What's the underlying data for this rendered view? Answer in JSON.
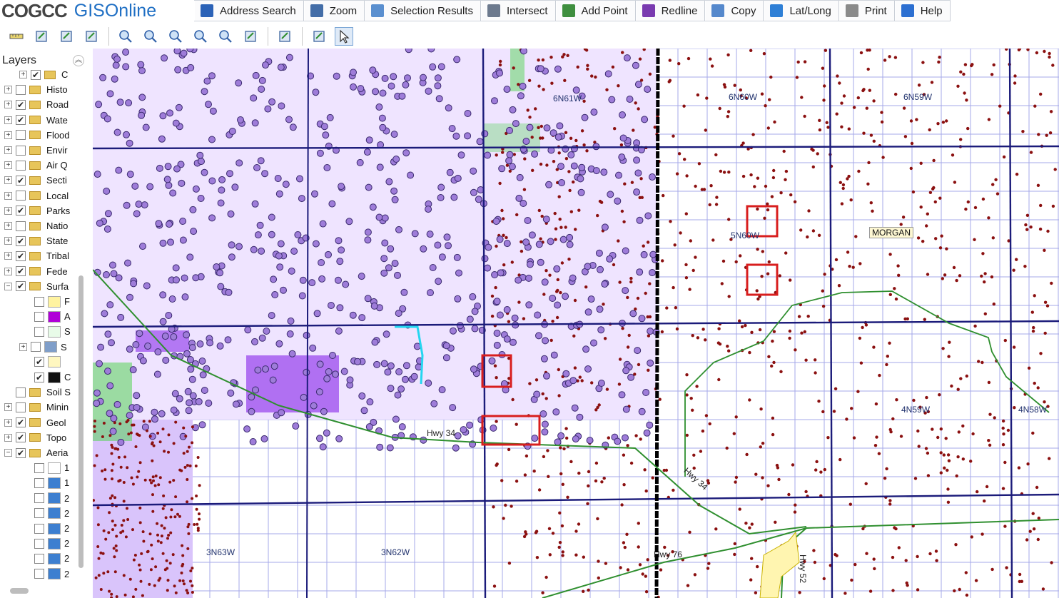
{
  "app": {
    "logo_brand": "COGCC",
    "logo_product": "GISOnline"
  },
  "menu": [
    {
      "key": "address_search",
      "label": "Address Search",
      "icon": "address-search-icon",
      "color": "#2b62b7"
    },
    {
      "key": "zoom",
      "label": "Zoom",
      "icon": "magnifier-icon",
      "color": "#446ea8"
    },
    {
      "key": "selection_results",
      "label": "Selection Results",
      "icon": "results-list-icon",
      "color": "#5a8fcf"
    },
    {
      "key": "intersect",
      "label": "Intersect",
      "icon": "intersect-cursor-icon",
      "color": "#6d7a8e"
    },
    {
      "key": "add_point",
      "label": "Add Point",
      "icon": "add-point-icon",
      "color": "#3f8f3f"
    },
    {
      "key": "redline",
      "label": "Redline",
      "icon": "redline-pencil-icon",
      "color": "#7a3bb0"
    },
    {
      "key": "copy",
      "label": "Copy",
      "icon": "copy-icon",
      "color": "#5588cc"
    },
    {
      "key": "lat_long",
      "label": "Lat/Long",
      "icon": "globe-icon",
      "color": "#2e7fd6"
    },
    {
      "key": "print",
      "label": "Print",
      "icon": "printer-icon",
      "color": "#8a8a8a"
    },
    {
      "key": "help",
      "label": "Help",
      "icon": "help-icon",
      "color": "#2c6fd1"
    }
  ],
  "toolbar": {
    "tools": [
      "measure-ruler-icon",
      "identify-tool-icon",
      "select-features-icon",
      "edit-pencil-icon",
      "zoom-box-icon",
      "zoom-in-icon",
      "zoom-out-icon",
      "zoom-previous-icon",
      "zoom-next-icon",
      "full-extent-icon",
      "clear-selection-icon",
      "layer-table-icon",
      "pointer-arrow-icon"
    ]
  },
  "layers_panel": {
    "title": "Layers",
    "items": [
      {
        "label": "C",
        "checked": true,
        "expander": "+",
        "indent": 1,
        "kind": "folder"
      },
      {
        "label": "Histo",
        "checked": false,
        "expander": "+",
        "indent": 0,
        "kind": "folder"
      },
      {
        "label": "Road",
        "checked": true,
        "expander": "+",
        "indent": 0,
        "kind": "folder"
      },
      {
        "label": "Wate",
        "checked": true,
        "expander": "+",
        "indent": 0,
        "kind": "folder"
      },
      {
        "label": "Flood",
        "checked": false,
        "expander": "+",
        "indent": 0,
        "kind": "folder"
      },
      {
        "label": "Envir",
        "checked": false,
        "expander": "+",
        "indent": 0,
        "kind": "folder"
      },
      {
        "label": "Air Q",
        "checked": false,
        "expander": "+",
        "indent": 0,
        "kind": "folder"
      },
      {
        "label": "Secti",
        "checked": true,
        "expander": "+",
        "indent": 0,
        "kind": "folder"
      },
      {
        "label": "Local",
        "checked": false,
        "expander": "+",
        "indent": 0,
        "kind": "folder"
      },
      {
        "label": "Parks",
        "checked": true,
        "expander": "+",
        "indent": 0,
        "kind": "folder"
      },
      {
        "label": "Natio",
        "checked": false,
        "expander": "+",
        "indent": 0,
        "kind": "folder"
      },
      {
        "label": "State",
        "checked": true,
        "expander": "+",
        "indent": 0,
        "kind": "folder"
      },
      {
        "label": "Tribal",
        "checked": true,
        "expander": "+",
        "indent": 0,
        "kind": "folder"
      },
      {
        "label": "Fede",
        "checked": true,
        "expander": "+",
        "indent": 0,
        "kind": "folder"
      },
      {
        "label": "Surfa",
        "checked": true,
        "expander": "−",
        "indent": 0,
        "kind": "folder"
      },
      {
        "label": "F",
        "checked": false,
        "expander": "",
        "indent": 2,
        "kind": "swatch",
        "swatch": "#fff3a0"
      },
      {
        "label": "A",
        "checked": false,
        "expander": "",
        "indent": 2,
        "kind": "swatch",
        "swatch": "#b000d8"
      },
      {
        "label": "S",
        "checked": false,
        "expander": "",
        "indent": 2,
        "kind": "swatch",
        "swatch": "#e8fbe8"
      },
      {
        "label": "S",
        "checked": false,
        "expander": "+",
        "indent": 1,
        "kind": "swatch",
        "swatch": "#7f9ec9"
      },
      {
        "label": "",
        "checked": true,
        "expander": "",
        "indent": 2,
        "kind": "swatch",
        "swatch": "#fff7c0"
      },
      {
        "label": "C",
        "checked": true,
        "expander": "",
        "indent": 2,
        "kind": "swatch",
        "swatch": "#111111"
      },
      {
        "label": "Soil S",
        "checked": false,
        "expander": "",
        "indent": 0,
        "kind": "folder"
      },
      {
        "label": "Minin",
        "checked": false,
        "expander": "+",
        "indent": 0,
        "kind": "folder"
      },
      {
        "label": "Geol",
        "checked": true,
        "expander": "+",
        "indent": 0,
        "kind": "folder"
      },
      {
        "label": "Topo",
        "checked": true,
        "expander": "+",
        "indent": 0,
        "kind": "folder"
      },
      {
        "label": "Aeria",
        "checked": true,
        "expander": "−",
        "indent": 0,
        "kind": "folder"
      },
      {
        "label": "1",
        "checked": false,
        "expander": "",
        "indent": 2,
        "kind": "swatch",
        "swatch": "#ffffff"
      },
      {
        "label": "1",
        "checked": false,
        "expander": "",
        "indent": 2,
        "kind": "swatch",
        "swatch": "#3d7fd0"
      },
      {
        "label": "2",
        "checked": false,
        "expander": "",
        "indent": 2,
        "kind": "swatch",
        "swatch": "#3d7fd0"
      },
      {
        "label": "2",
        "checked": false,
        "expander": "",
        "indent": 2,
        "kind": "swatch",
        "swatch": "#3d7fd0"
      },
      {
        "label": "2",
        "checked": false,
        "expander": "",
        "indent": 2,
        "kind": "swatch",
        "swatch": "#3d7fd0"
      },
      {
        "label": "2",
        "checked": false,
        "expander": "",
        "indent": 2,
        "kind": "swatch",
        "swatch": "#3d7fd0"
      },
      {
        "label": "2",
        "checked": false,
        "expander": "",
        "indent": 2,
        "kind": "swatch",
        "swatch": "#3d7fd0"
      },
      {
        "label": "2",
        "checked": false,
        "expander": "",
        "indent": 2,
        "kind": "swatch",
        "swatch": "#3d7fd0"
      }
    ]
  },
  "map": {
    "township_labels": [
      "6N61W",
      "6N60W",
      "6N59W",
      "5N60W",
      "4N59W",
      "4N58W",
      "3N63W",
      "3N62W"
    ],
    "highway_labels": [
      "Hwy 34",
      "Hwy 34",
      "Hwy 76",
      "Hwy 52"
    ],
    "county_label": "MORGAN",
    "colors": {
      "well_dot": "#8b1010",
      "well_bubble": "#9e7cd9",
      "well_bubble_stroke": "#3a2a6e",
      "grid_line": "#a6a8e8",
      "township_line": "#1b1b7a",
      "county_line": "#000000",
      "highway": "#2f8f2f",
      "selection_box": "#d81e1e",
      "purple_fill": "#a45cf0",
      "green_hatch": "#55d455"
    }
  }
}
